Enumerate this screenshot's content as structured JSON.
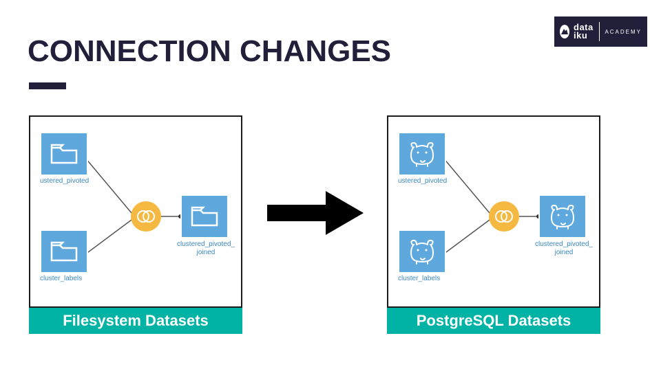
{
  "brand": {
    "line1": "data",
    "line2": "iku",
    "academy": "ACADEMY"
  },
  "title": "CONNECTION CHANGES",
  "diagrams": {
    "left": {
      "caption": "Filesystem Datasets",
      "nodes": {
        "top_input": "ustered_pivoted",
        "bottom_input": "cluster_labels",
        "output": "clustered_pivoted_joined",
        "output_line2": "joined"
      }
    },
    "right": {
      "caption": "PostgreSQL Datasets",
      "nodes": {
        "top_input": "ustered_pivoted",
        "bottom_input": "cluster_labels",
        "output": "clustered_pivoted_joined",
        "output_line2": "joined"
      }
    }
  },
  "colors": {
    "brand_bg": "#221f3b",
    "accent": "#00b3a4",
    "node_bg": "#5ea8dd",
    "recipe_bg": "#f5b942"
  }
}
